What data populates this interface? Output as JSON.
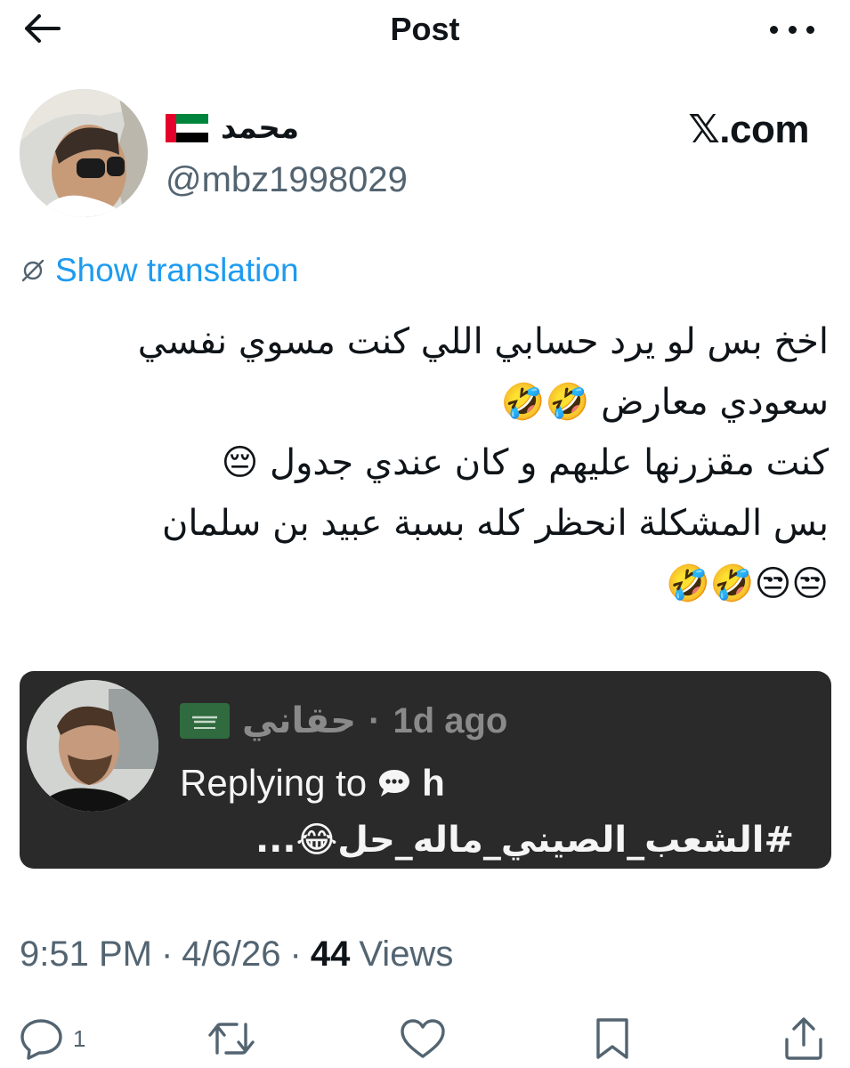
{
  "header": {
    "title": "Post"
  },
  "post": {
    "display_name": "محمد",
    "handle": "@mbz1998029",
    "watermark": "𝕏.com",
    "translate_label": "Show translation",
    "lines": [
      "اخخ بس لو يرد حسابي اللي كنت مسوي نفسي",
      "سعودي معارض 🤣🤣",
      "كنت مقزرنها عليهم و كان عندي جدول 😔",
      "بس المشكلة انحظر كله بسبة عبيد بن سلمان",
      "😒😒🤣🤣"
    ]
  },
  "quote": {
    "name": "حقاني",
    "separator": "·",
    "time": "1d ago",
    "replying_label": "Replying to",
    "replying_handle": "h",
    "hashtag": "#الشعب_الصيني_ماله_حل😂..."
  },
  "meta": {
    "time": "9:51 PM",
    "sep1": "·",
    "date": "4/6/26",
    "sep2": "·",
    "views_count": "44",
    "views_label": "Views"
  },
  "actions": {
    "reply_count": "1"
  },
  "colors": {
    "accent": "#1d9bf0",
    "text": "#0f1419",
    "muted": "#536471",
    "quote_bg": "#2a2a2a"
  },
  "icons": [
    "back-arrow-icon",
    "more-icon",
    "uae-flag-icon",
    "globe-slash-icon",
    "saudi-flag-icon",
    "speech-bubble-icon",
    "reply-icon",
    "repost-icon",
    "like-icon",
    "bookmark-icon",
    "share-icon"
  ]
}
